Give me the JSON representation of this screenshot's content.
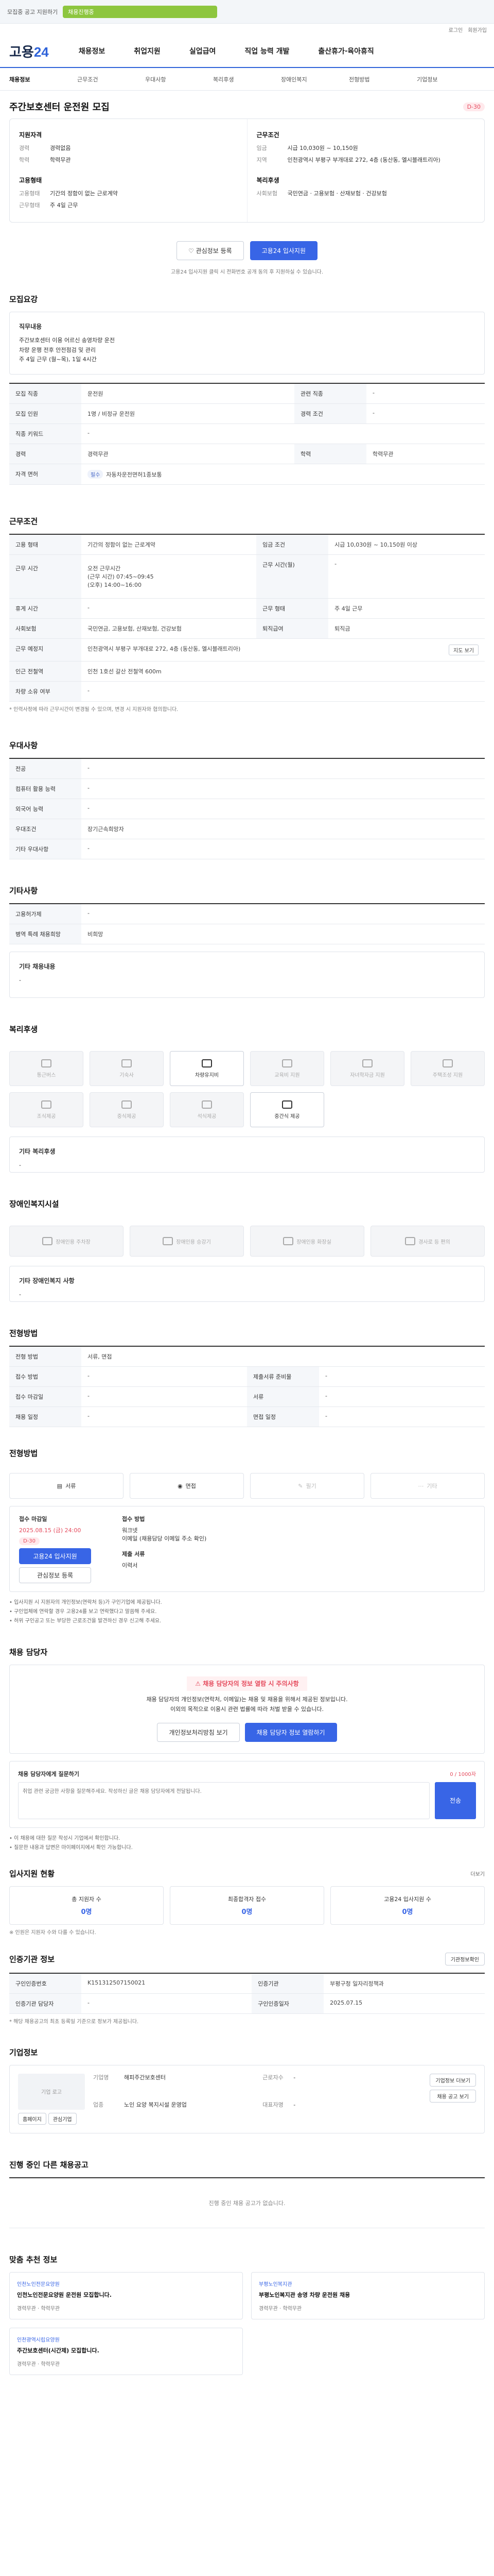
{
  "topbar": {
    "notice": "모집중 공고 지원하기",
    "status": "채용진행중"
  },
  "util": {
    "links": [
      "로그인",
      "회원가입"
    ]
  },
  "header": {
    "logo_a": "고용",
    "logo_b": "24",
    "nav": [
      "채용정보",
      "취업지원",
      "실업급여",
      "직업 능력 개발",
      "출산휴가·육아휴직"
    ]
  },
  "subnav": [
    "채용정보",
    "근무조건",
    "우대사항",
    "복리후생",
    "장애인복지",
    "전형방법",
    "기업정보"
  ],
  "job": {
    "title": "주간보호센터 운전원 모집",
    "dday": "D-30",
    "recruit_label": "지원자격",
    "recruit": [
      {
        "k": "경력",
        "v": "경력없음"
      },
      {
        "k": "학력",
        "v": "학력무관"
      }
    ],
    "condition_label": "근무조건",
    "condition": [
      {
        "k": "임금",
        "v": "시급 10,030원 ~ 10,150원"
      },
      {
        "k": "지역",
        "v": "인천광역시 부평구 부개대로 272, 4층 (동산동, 엘시블래트리아)"
      }
    ],
    "employ_label": "고용형태",
    "employ": [
      {
        "k": "고용형태",
        "v": "기간의 정함이 없는 근로계약"
      },
      {
        "k": "근무형태",
        "v": "주 4일 근무"
      }
    ],
    "welfare_label": "복리후생",
    "welfare": [
      {
        "k": "사회보험",
        "v": "국민연금 · 고용보험 · 산재보험 · 건강보험"
      }
    ]
  },
  "actions": {
    "save": "관심정보 등록",
    "apply": "고용24 입사지원"
  },
  "hint": "고용24 입사지원 클릭 시 전화번호 공개 동의 후 지원하실 수 있습니다.",
  "sec_recruit": "모집요강",
  "duty": {
    "title": "직무내용",
    "lines": [
      "주간보호센터 이용 어르신 송영차량 운전",
      "차량 운행 전후 안전점검 및 관리",
      "주 4일 근무 (월~목), 1일 4시간"
    ]
  },
  "recruit_table": [
    {
      "k": "모집 직종",
      "v": "운전원",
      "k2": "관련 직종",
      "v2": "-"
    },
    {
      "k": "모집 인원",
      "v": "1명 / 비정규 운전원",
      "k2": "경력 조건",
      "v2": "-"
    },
    {
      "k": "직종 키워드",
      "v": "-",
      "k2": "",
      "v2": ""
    },
    {
      "k": "경력",
      "v": "경력무관",
      "k2": "학력",
      "v2": "학력무관"
    }
  ],
  "license_label": "자격 면허",
  "license_tag": "필수",
  "license": "자동차운전면허1종보통",
  "sec_condition": "근무조건",
  "cond_table": [
    {
      "k": "고용 형태",
      "v": "기간의 정함이 없는 근로계약",
      "k2": "임금 조건",
      "v2": "시급 10,030원 ~ 10,150원 이상"
    }
  ],
  "work_time": {
    "label": "근무 시간",
    "lines": [
      "오전 근무시간",
      "(근무 시간) 07:45~09:45",
      "(오후) 14:00~16:00"
    ],
    "k2": "근무 시간(월)",
    "v2": "-"
  },
  "cond_table2": [
    {
      "k": "휴게 시간",
      "v": "-",
      "k2": "근무 형태",
      "v2": "주 4일 근무"
    },
    {
      "k": "사회보험",
      "v": "국민연금, 고용보험, 산재보험, 건강보험",
      "k2": "퇴직급여",
      "v2": "퇴직금"
    }
  ],
  "location": {
    "label": "근무 예정지",
    "value": "인천광역시 부평구 부개대로 272, 4층 (동산동, 엘시블래트리아)",
    "btn": "지도 보기"
  },
  "near": {
    "label": "인근 전철역",
    "value": "인천 1호선 갈산 전철역 600m"
  },
  "car": {
    "label": "차량 소유 여부",
    "value": "-"
  },
  "cond_note": "* 인력사정에 따라 근무시간이 변경될 수 있으며, 변경 시 지원자와 협의합니다.",
  "sec_pref": "우대사항",
  "pref_table": [
    {
      "k": "전공",
      "v": "-"
    },
    {
      "k": "컴퓨터 활용 능력",
      "v": "-"
    },
    {
      "k": "외국어 능력",
      "v": "-"
    },
    {
      "k": "우대조건",
      "v": "장기근속희망자"
    },
    {
      "k": "기타 우대사항",
      "v": "-"
    }
  ],
  "sec_etc": "기타사항",
  "etc_table": [
    {
      "k": "고용허가제",
      "v": "-"
    },
    {
      "k": "병역 특례 채용희망",
      "v": "비희망"
    }
  ],
  "etc_note_label": "기타 채용내용",
  "etc_note": "-",
  "sec_welfare": "복리후생",
  "welfare_items": [
    {
      "icon": "bus-icon",
      "label": "통근버스",
      "on": false
    },
    {
      "icon": "meal-icon",
      "label": "기숙사",
      "on": false
    },
    {
      "icon": "car-icon",
      "label": "차량유지비",
      "on": true
    },
    {
      "icon": "edu-icon",
      "label": "교육비 지원",
      "on": false
    },
    {
      "icon": "child-icon",
      "label": "자녀학자금 지원",
      "on": false
    },
    {
      "icon": "house-icon",
      "label": "주택조성 지원",
      "on": false
    },
    {
      "icon": "cafe-icon",
      "label": "조식제공",
      "on": false
    },
    {
      "icon": "lunch-icon",
      "label": "중식제공",
      "on": false
    },
    {
      "icon": "dinner-icon",
      "label": "석식제공",
      "on": false
    },
    {
      "icon": "etc-icon",
      "label": "중간식 제공",
      "on": true
    }
  ],
  "welfare_etc_label": "기타 복리후생",
  "welfare_etc": "-",
  "sec_disabled": "장애인복지시설",
  "disabled_items": [
    "장애인용 주차장",
    "장애인용 승강기",
    "장애인용 화장실",
    "경사로 등 편의"
  ],
  "disabled_etc_label": "기타 장애인복지 사항",
  "disabled_etc": "-",
  "sec_selection": "전형방법",
  "select_table": [
    {
      "k": "전형 방법",
      "v": "서류, 면접"
    },
    {
      "k": "접수 방법",
      "v": "-",
      "k2": "제출서류 준비물",
      "v2": "-"
    },
    {
      "k": "접수 마감일",
      "v": "-",
      "k2": "서류",
      "v2": "-"
    },
    {
      "k": "채용 일정",
      "v": "-",
      "k2": "면접 일정",
      "v2": "-"
    }
  ],
  "sec_method": "전형방법",
  "methods": [
    {
      "label": "서류",
      "on": true
    },
    {
      "label": "면접",
      "on": true
    },
    {
      "label": "필기",
      "on": false
    },
    {
      "label": "기타",
      "on": false
    }
  ],
  "apply_box": {
    "period_label": "접수 마감일",
    "period": "2025.08.15 (금) 24:00",
    "dday": "D-30",
    "apply_btn": "고용24 입사지원",
    "save_btn": "관심정보 등록",
    "docs_label": "접수 방법",
    "docs": [
      "워크넷",
      "이메일 (채용담당 이메일 주소 확인)"
    ],
    "note_label": "제출 서류",
    "note": "이력서"
  },
  "bullets": [
    "• 입사지원 시 지원자의 개인정보(연락처 등)가 구인기업에 제공됩니다.",
    "• 구인업체에 연락할 경우 고용24를 보고 연락했다고 말씀해 주세요.",
    "• 허위 구인공고 또는 부당한 근로조건을 발견하신 경우 신고해 주세요."
  ],
  "sec_contact": "채용 담당자",
  "alert": {
    "warn": "채용 담당자의 정보 열람 시 주의사항",
    "lines": [
      "채용 담당자의 개인정보(연락처, 이메일)는 채용 및 채용을 위해서 제공된 정보입니다.",
      "이외의 목적으로 이용시 관련 법률에 따라 처벌 받을 수 있습니다."
    ],
    "btn1": "개인정보처리방침 보기",
    "btn2": "채용 담당자 정보 열람하기"
  },
  "qa": {
    "title": "채용 담당자에게 질문하기",
    "count": "0 / 1000자",
    "placeholder": "취업 관련 궁금한 사항을 질문해주세요. 작성하신 글은 채용 담당자에게 전달됩니다.",
    "btn": "전송"
  },
  "qa_notes": [
    "• 이 채용에 대한 질문 작성시 기업에서 확인합니다.",
    "• 질문한 내용과 답변은 마이페이지에서 확인 가능합니다."
  ],
  "sec_stats": "입사지원 현황",
  "stats_more": "더보기",
  "stats": [
    {
      "label": "총 지원자 수",
      "value": "0명"
    },
    {
      "label": "최종합격자 접수",
      "value": "0명"
    },
    {
      "label": "고용24 입사지원 수",
      "value": "0명"
    }
  ],
  "stats_note": "※ 인원은 지원자 수와 다를 수 있습니다.",
  "sec_info": "인증기관 정보",
  "info_btn": "기관정보확인",
  "info_table": [
    {
      "k": "구인인증번호",
      "v": "K151312507150021",
      "k2": "인증기관",
      "v2": "부평구청 일자리정책과"
    },
    {
      "k": "인증기관 담당자",
      "v": "-",
      "k2": "구인인증일자",
      "v2": "2025.07.15"
    }
  ],
  "info_note": "* 해당 채용공고의 최초 등록일 기준으로 정보가 제공됩니다.",
  "sec_company": "기업정보",
  "company": {
    "logo": "기업 로고",
    "btn1": "홈페이지",
    "btn2": "관심기업",
    "rows": [
      {
        "k": "기업명",
        "v": "해피주간보호센터"
      },
      {
        "k": "업종",
        "v": "노인 요양 복지시설 운영업"
      },
      {
        "k": "근로자수",
        "v": "-"
      },
      {
        "k": "대표자명",
        "v": "-"
      }
    ],
    "btn3": "기업정보 더보기",
    "btn4": "채용 공고 보기"
  },
  "sec_others": "진행 중인 다른 채용공고",
  "others_empty": "진행 중인 채용 공고가 없습니다.",
  "sec_reco": "맞춤 추천 정보",
  "reco": [
    {
      "org": "인천노인전문요양원",
      "title": "인천노인전문요양원 운전원 모집합니다.",
      "meta": "경력무관 · 학력무관"
    },
    {
      "org": "부평노인복지관",
      "title": "부평노인복지관 송영 차량 운전원 채용",
      "meta": "경력무관 · 학력무관"
    },
    {
      "org": "인천광역시립요양원",
      "title": "주간보호센터(시간제) 모집합니다.",
      "meta": "경력무관 · 학력무관"
    }
  ]
}
